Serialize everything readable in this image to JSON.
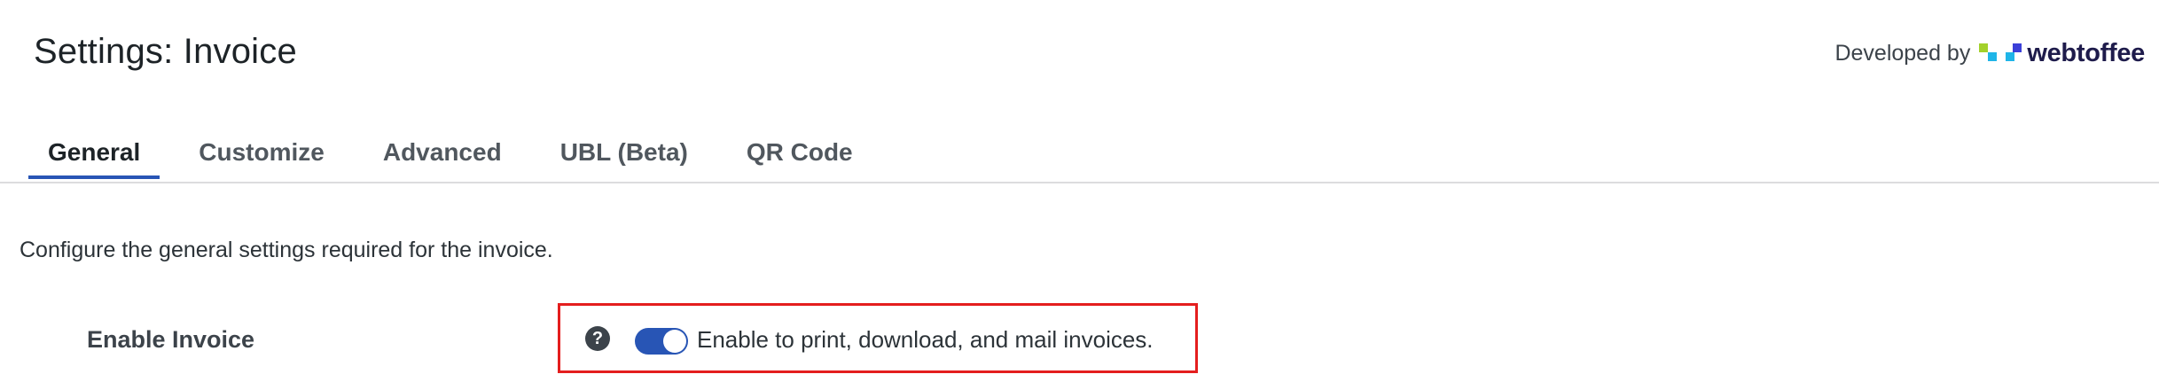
{
  "header": {
    "title": "Settings: Invoice",
    "developed_by": "Developed by",
    "brand": "webtoffee",
    "brand_colors": [
      "#a3d12b",
      "#1fb5e8",
      "#3b3fd8"
    ]
  },
  "tabs": [
    {
      "label": "General",
      "active": true
    },
    {
      "label": "Customize",
      "active": false
    },
    {
      "label": "Advanced",
      "active": false
    },
    {
      "label": "UBL (Beta)",
      "active": false
    },
    {
      "label": "QR Code",
      "active": false
    }
  ],
  "main": {
    "description": "Configure the general settings required for the invoice.",
    "fields": [
      {
        "label": "Enable Invoice",
        "help_icon": "question-circle-icon",
        "help_glyph": "?",
        "toggle_on": true,
        "toggle_label": "Enable to print, download, and mail invoices."
      }
    ]
  },
  "colors": {
    "accent": "#2855b5",
    "highlight": "#e41e1e"
  }
}
